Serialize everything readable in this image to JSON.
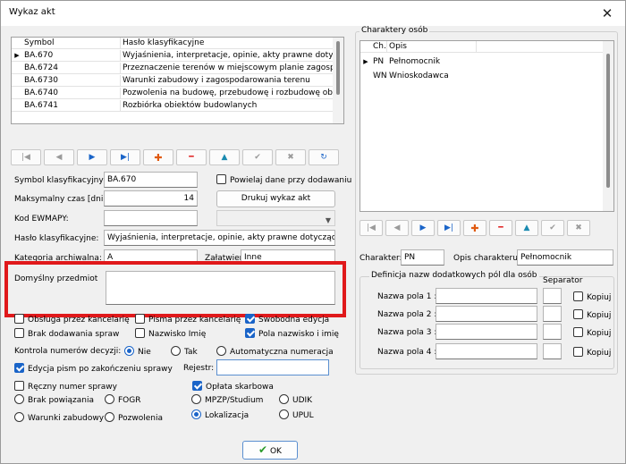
{
  "window": {
    "title": "Wykaz akt",
    "close_glyph": "✕"
  },
  "classification_grid": {
    "headers": [
      "Symbol",
      "Hasło klasyfikacyjne"
    ],
    "rows": [
      {
        "symbol": "BA.670",
        "name": "Wyjaśnienia, interpretacje, opinie, akty prawne dotyczące"
      },
      {
        "symbol": "BA.6724",
        "name": "Przeznaczenie terenów w miejscowym planie zagospodar"
      },
      {
        "symbol": "BA.6730",
        "name": "Warunki zabudowy i zagospodarowania terenu"
      },
      {
        "symbol": "BA.6740",
        "name": "Pozwolenia na budowę, przebudowę i rozbudowę obiekt"
      },
      {
        "symbol": "BA.6741",
        "name": "Rozbiórka obiektów budowlanych"
      }
    ],
    "current_marker": "▶"
  },
  "nav_icons": [
    "first-icon",
    "prior-icon",
    "next-icon",
    "last-icon",
    "insert-icon",
    "delete-icon",
    "edit-icon",
    "post-icon",
    "cancel-icon",
    "refresh-icon"
  ],
  "nav_glyphs": {
    "first": "|◀",
    "prior": "◀",
    "next": "▶",
    "last": "▶|",
    "insert": "✚",
    "delete": "━",
    "edit": "▲",
    "post": "✔",
    "cancel": "✖",
    "refresh": "↻"
  },
  "form": {
    "symbol_label": "Symbol klasyfikacyjny:",
    "symbol_value": "BA.670",
    "max_time_label": "Maksymalny czas [dni]:",
    "max_time_value": "14",
    "ewmapy_label": "Kod EWMAPY:",
    "ewmapy_value": "",
    "haslo_label": "Hasło klasyfikacyjne:",
    "haslo_value": "Wyjaśnienia, interpretacje, opinie, akty prawne dotyczące plar",
    "kategoria_label": "Kategoria archiwalna:",
    "kategoria_value": "A",
    "zalatwienie_label": "Załatwienie:",
    "zalatwienie_value": "Inne",
    "repeat_label": "Powielaj dane przy dodawaniu",
    "print_button": "Drukuj wykaz akt",
    "default_subject_label": "Domyślny przedmiot",
    "default_subject_value": ""
  },
  "options": {
    "obsluga": "Obsługa przez kancelarię",
    "pisma": "Pisma przez kancelarię",
    "swobodna": "Swobodna edycja",
    "brak_dodawania": "Brak dodawania spraw",
    "nazwisko_imie": "Nazwisko Imię",
    "pola_nazwisko": "Pola nazwisko i imię",
    "kontrola_label": "Kontrola numerów decyzji:",
    "nie": "Nie",
    "tak": "Tak",
    "automatyczna": "Automatyczna numeracja",
    "edycja_pism": "Edycja pism po zakończeniu sprawy",
    "rejestr_label": "Rejestr:",
    "rejestr_value": "",
    "reczny": "Ręczny numer sprawy",
    "oplata": "Opłata skarbowa",
    "brak_powiazania": "Brak powiązania",
    "fogr": "FOGR",
    "mpzp": "MPZP/Studium",
    "udik": "UDIK",
    "warunki": "Warunki zabudowy",
    "pozwolenia": "Pozwolenia",
    "lokalizacja": "Lokalizacja",
    "upul": "UPUL"
  },
  "persons": {
    "group_title": "Charaktery osób",
    "headers": [
      "Ch.",
      "Opis"
    ],
    "rows": [
      {
        "code": "PN",
        "desc": "Pełnomocnik"
      },
      {
        "code": "WN",
        "desc": "Wnioskodawca"
      }
    ],
    "character_label": "Charakter:",
    "character_value": "PN",
    "desc_label": "Opis charakteru:",
    "desc_value": "Pełnomocnik",
    "fields_group_title": "Definicja nazw dodatkowych pól  dla osób",
    "separator_label": "Separator",
    "field_labels": [
      "Nazwa pola 1 :",
      "Nazwa pola 2 :",
      "Nazwa pola 3 :",
      "Nazwa pola 4 :"
    ],
    "kopiuj_label": "Kopiuj"
  },
  "ok_button": {
    "label": "OK",
    "glyph": "✔"
  },
  "colors": {
    "highlight_frame": "#e0191b",
    "accent": "#1a64c8",
    "ok_check": "#2a9a2a"
  }
}
